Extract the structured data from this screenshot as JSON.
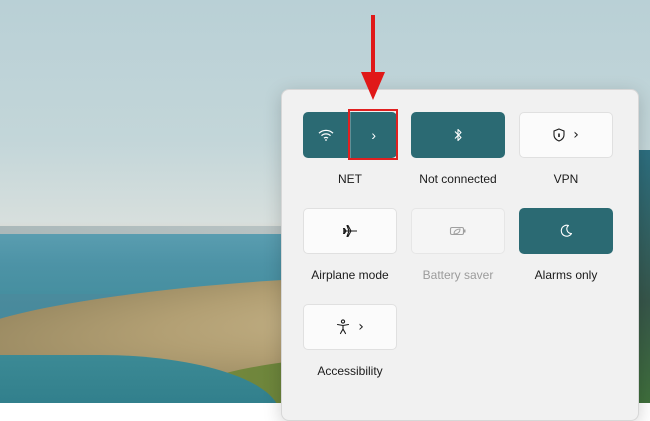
{
  "quick_settings": {
    "tiles": [
      {
        "label": "NET",
        "state": "on",
        "icon": "wifi-icon",
        "has_chevron": true,
        "chevron": "›"
      },
      {
        "label": "Not connected",
        "state": "on",
        "icon": "bluetooth-icon",
        "has_chevron": false
      },
      {
        "label": "VPN",
        "state": "off",
        "icon": "shield-icon",
        "has_chevron": true,
        "chevron": "›"
      },
      {
        "label": "Airplane mode",
        "state": "off",
        "icon": "airplane-icon",
        "has_chevron": false
      },
      {
        "label": "Battery saver",
        "state": "disabled",
        "icon": "battery-saver-icon",
        "has_chevron": false
      },
      {
        "label": "Alarms only",
        "state": "on",
        "icon": "moon-icon",
        "has_chevron": false
      },
      {
        "label": "Accessibility",
        "state": "off",
        "icon": "accessibility-icon",
        "has_chevron": true,
        "chevron": "›"
      }
    ]
  },
  "colors": {
    "accent": "#2b6a73",
    "annotation_red": "#e01818"
  }
}
